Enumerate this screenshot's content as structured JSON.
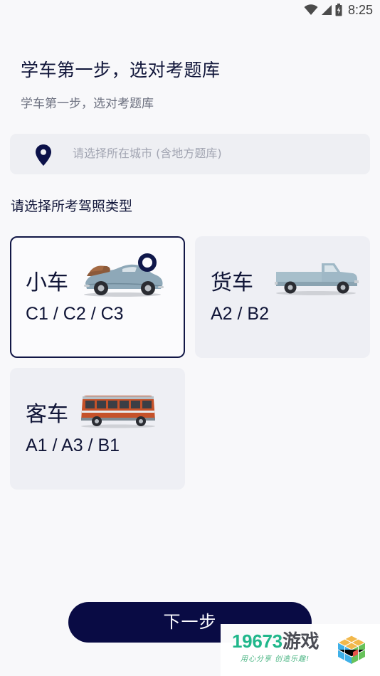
{
  "status_bar": {
    "time": "8:25",
    "icons": [
      "wifi-icon",
      "signal-icon",
      "battery-charging-icon"
    ]
  },
  "header": {
    "title": "学车第一步，选对考题库",
    "subtitle": "学车第一步，选对考题库"
  },
  "location": {
    "icon": "location-pin-icon",
    "placeholder": "请选择所在城市 (含地方题库)"
  },
  "license_section": {
    "title": "请选择所考驾照类型",
    "options": [
      {
        "name": "小车",
        "codes": "C1 / C2 / C3",
        "image": "vintage-convertible-car-image",
        "selected": true
      },
      {
        "name": "货车",
        "codes": "A2 / B2",
        "image": "pickup-truck-image",
        "selected": false
      },
      {
        "name": "客车",
        "codes": "A1 / A3 / B1",
        "image": "red-bus-image",
        "selected": false
      }
    ]
  },
  "footer": {
    "next_label": "下一步"
  },
  "watermark": {
    "main": "19673",
    "brand": "游戏",
    "slogan": "用心分享 创造乐趣!"
  },
  "colors": {
    "background": "#f8f8fa",
    "primary_navy": "#090b44",
    "text_primary": "#11163a",
    "text_secondary": "#6d7180",
    "card_bg": "#eeeff4",
    "placeholder": "#a2a5b2",
    "watermark_green": "#20b78b"
  }
}
